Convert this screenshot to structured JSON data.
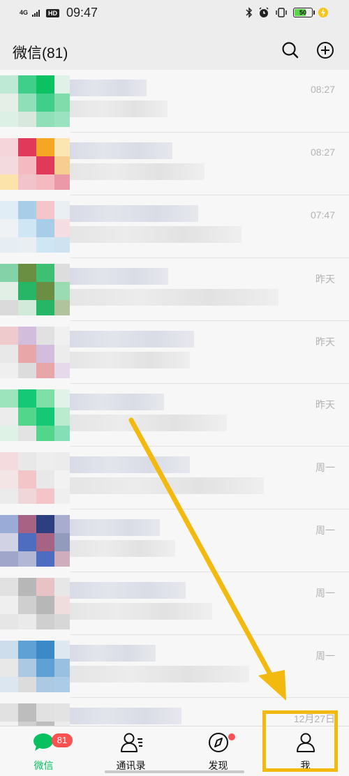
{
  "status_bar": {
    "network": "4G",
    "hd": "HD",
    "time": "09:47",
    "battery": "50",
    "icons": [
      "bluetooth-icon",
      "alarm-icon",
      "vibrate-icon",
      "battery-icon",
      "charging-icon"
    ]
  },
  "header": {
    "title": "微信(81)",
    "actions": [
      "search-icon",
      "add-icon"
    ]
  },
  "chats": [
    {
      "time": "08:27"
    },
    {
      "time": "08:27"
    },
    {
      "time": "07:47"
    },
    {
      "time": "昨天"
    },
    {
      "time": "昨天"
    },
    {
      "time": "昨天"
    },
    {
      "time": "周一"
    },
    {
      "time": "周一"
    },
    {
      "time": "周一"
    },
    {
      "time": "周一"
    },
    {
      "time": "12月27日"
    }
  ],
  "tabbar": {
    "tabs": [
      {
        "label": "微信",
        "icon": "chat-bubble-icon",
        "badge": "81",
        "active": true
      },
      {
        "label": "通讯录",
        "icon": "contacts-icon"
      },
      {
        "label": "发现",
        "icon": "compass-icon",
        "dot": true
      },
      {
        "label": "我",
        "icon": "profile-icon"
      }
    ]
  },
  "colors": {
    "accent": "#07c160",
    "badge": "#fa5151",
    "highlight": "#f2b90f",
    "background": "#ededed"
  }
}
